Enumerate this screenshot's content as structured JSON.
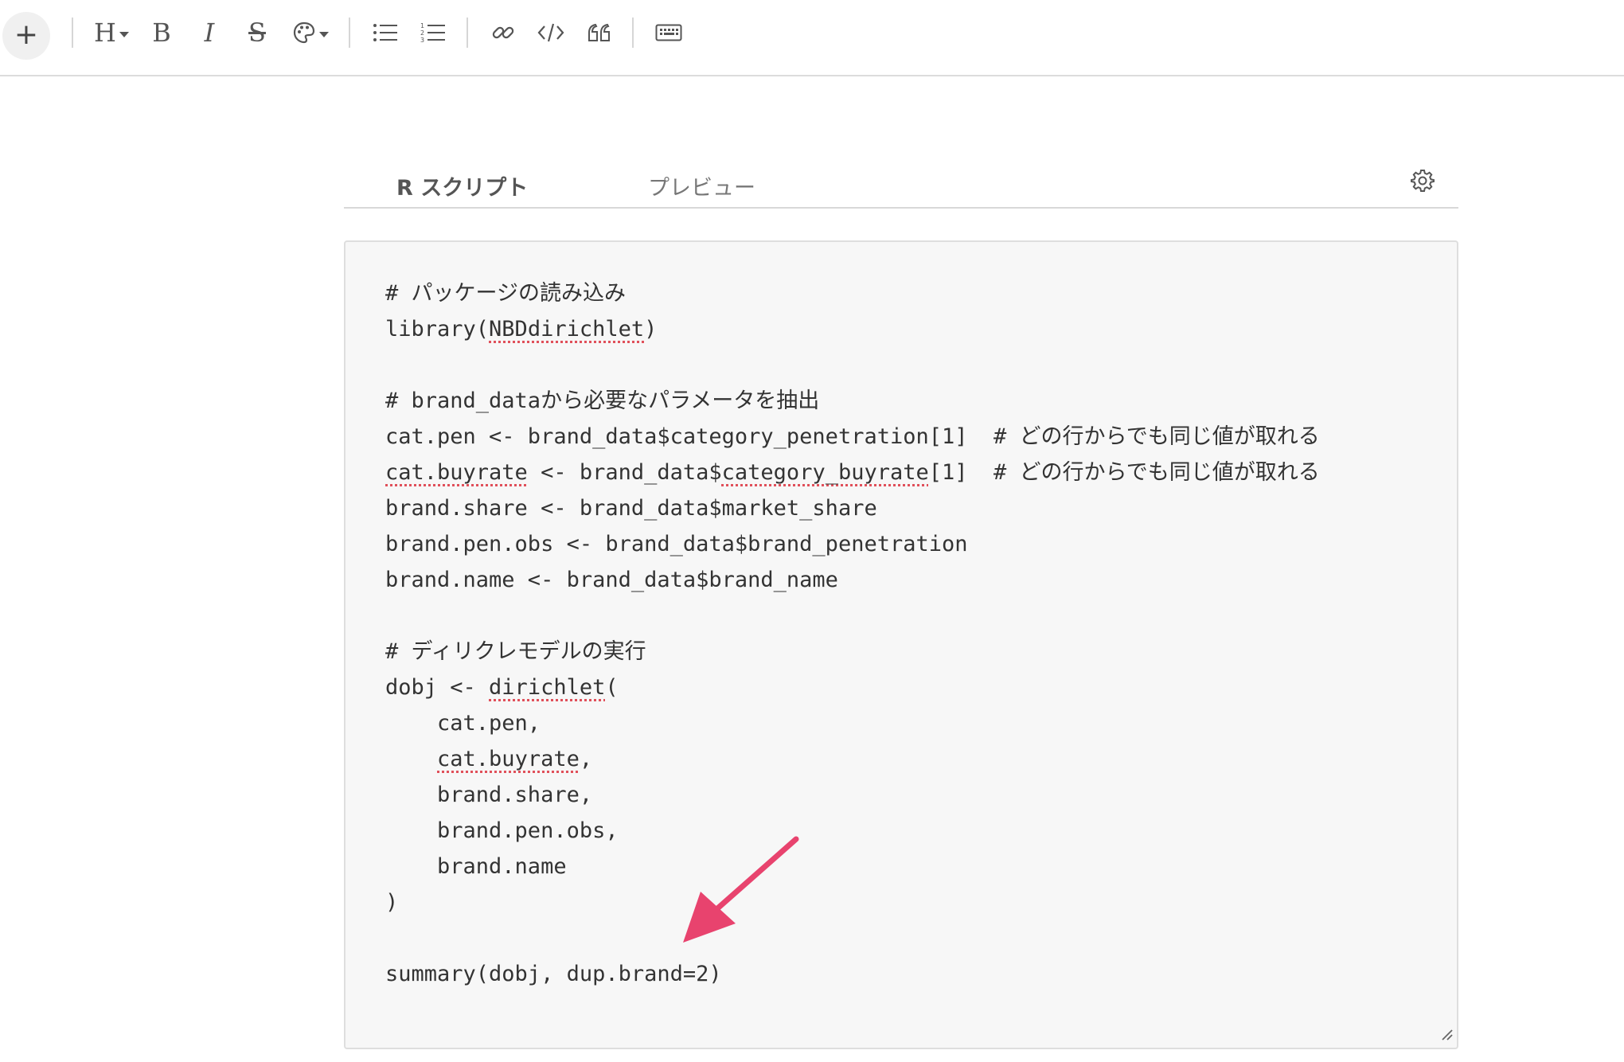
{
  "toolbar": {
    "plus_label": "+",
    "heading_label": "H",
    "bold_label": "B",
    "italic_label": "I",
    "strike_label": "S"
  },
  "tabs": [
    {
      "label": "R スクリプト",
      "active": true
    },
    {
      "label": "プレビュー",
      "active": false
    }
  ],
  "code_lines": [
    [
      {
        "t": "# パッケージの読み込み"
      }
    ],
    [
      {
        "t": "library("
      },
      {
        "t": "NBDdirichlet",
        "spell": true
      },
      {
        "t": ")"
      }
    ],
    [
      {
        "t": ""
      }
    ],
    [
      {
        "t": "# brand_dataから必要なパラメータを抽出"
      }
    ],
    [
      {
        "t": "cat.pen <- brand_data$category_penetration[1]  # どの行からでも同じ値が取れる"
      }
    ],
    [
      {
        "t": "cat.buyrate",
        "spell": true
      },
      {
        "t": " <- brand_data$"
      },
      {
        "t": "category_buyrate",
        "spell": true
      },
      {
        "t": "[1]  # どの行からでも同じ値が取れる"
      }
    ],
    [
      {
        "t": "brand.share <- brand_data$market_share"
      }
    ],
    [
      {
        "t": "brand.pen.obs <- brand_data$brand_penetration"
      }
    ],
    [
      {
        "t": "brand.name <- brand_data$brand_name"
      }
    ],
    [
      {
        "t": ""
      }
    ],
    [
      {
        "t": "# ディリクレモデルの実行"
      }
    ],
    [
      {
        "t": "dobj <- "
      },
      {
        "t": "dirichlet",
        "spell": true
      },
      {
        "t": "("
      }
    ],
    [
      {
        "t": "    cat.pen,"
      }
    ],
    [
      {
        "t": "    "
      },
      {
        "t": "cat.buyrate",
        "spell": true
      },
      {
        "t": ","
      }
    ],
    [
      {
        "t": "    brand.share,"
      }
    ],
    [
      {
        "t": "    brand.pen.obs,"
      }
    ],
    [
      {
        "t": "    brand.name"
      }
    ],
    [
      {
        "t": ")"
      }
    ],
    [
      {
        "t": ""
      }
    ],
    [
      {
        "t": "summary(dobj, dup.brand=2)"
      }
    ]
  ],
  "colors": {
    "accent_arrow": "#e8436e",
    "spell_underline": "#e0505a",
    "code_bg": "#f7f7f7"
  },
  "icons": [
    "plus-icon",
    "heading-icon",
    "bold-icon",
    "italic-icon",
    "strikethrough-icon",
    "palette-icon",
    "bullet-list-icon",
    "numbered-list-icon",
    "link-icon",
    "code-icon",
    "quote-icon",
    "keyboard-icon",
    "gear-icon",
    "resize-handle-icon",
    "arrow-annotation-icon"
  ]
}
